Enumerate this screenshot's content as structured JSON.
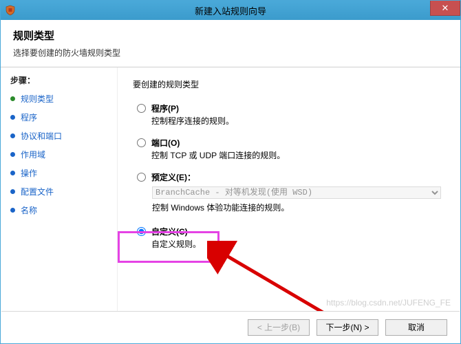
{
  "window": {
    "title": "新建入站规则向导",
    "close_glyph": "✕"
  },
  "header": {
    "title": "规则类型",
    "subtitle": "选择要创建的防火墙规则类型"
  },
  "sidebar": {
    "steps_label": "步骤：",
    "items": [
      {
        "label": "规则类型",
        "state": "current"
      },
      {
        "label": "程序",
        "state": "pending"
      },
      {
        "label": "协议和端口",
        "state": "pending"
      },
      {
        "label": "作用域",
        "state": "pending"
      },
      {
        "label": "操作",
        "state": "pending"
      },
      {
        "label": "配置文件",
        "state": "pending"
      },
      {
        "label": "名称",
        "state": "pending"
      }
    ]
  },
  "main": {
    "prompt": "要创建的规则类型",
    "options": {
      "program": {
        "title": "程序(P)",
        "desc": "控制程序连接的规则。",
        "selected": false
      },
      "port": {
        "title": "端口(O)",
        "desc": "控制 TCP 或 UDP 端口连接的规则。",
        "selected": false
      },
      "predefined": {
        "title": "预定义(E)：",
        "selected": false,
        "dropdown_value": "BranchCache - 对等机发现(使用 WSD)",
        "desc": "控制 Windows 体验功能连接的规则。"
      },
      "custom": {
        "title": "自定义(C)",
        "desc": "自定义规则。",
        "selected": true
      }
    }
  },
  "footer": {
    "back": "< 上一步(B)",
    "next": "下一步(N) >",
    "cancel": "取消"
  },
  "watermark": "https://blog.csdn.net/JUFENG_FE"
}
